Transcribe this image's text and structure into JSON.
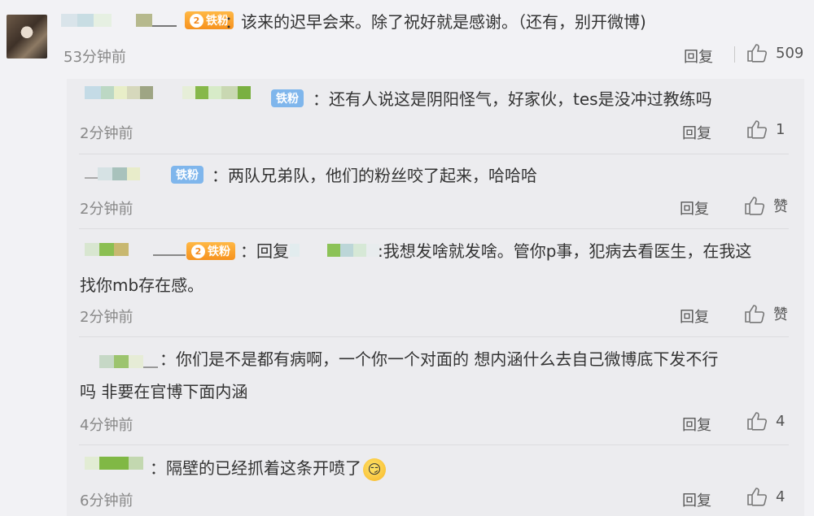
{
  "main_comment": {
    "badge": "铁粉",
    "badge_level": "2",
    "text": "：该来的迟早会来。除了祝好就是感谢。（还有，别开微博)",
    "time": "53分钟前",
    "reply_label": "回复",
    "likes": "509"
  },
  "replies": [
    {
      "badge": "铁粉",
      "text": "：还有人说这是阴阳怪气，好家伙，tes是没冲过教练吗",
      "time": "2分钟前",
      "reply_label": "回复",
      "likes": "1"
    },
    {
      "badge": "铁粉",
      "text": "：两队兄弟队，他们的粉丝咬了起来，哈哈哈",
      "time": "2分钟前",
      "reply_label": "回复",
      "likes": "赞"
    },
    {
      "badge": "铁粉",
      "badge_level": "2",
      "text_line1_a": "：回复",
      "text_line1_b": ":我想发啥就发啥。管你p事，犯病去看医生，在我这",
      "text_line2": "找你mb存在感。",
      "time": "2分钟前",
      "reply_label": "回复",
      "likes": "赞"
    },
    {
      "text_line1": "：你们是不是都有病啊，一个你一个对面的  想内涵什么去自己微博底下发不行",
      "text_line2": "吗  非要在官博下面内涵",
      "time": "4分钟前",
      "reply_label": "回复",
      "likes": "4"
    },
    {
      "text": "：隔壁的已经抓着这条开喷了",
      "time": "6分钟前",
      "reply_label": "回复",
      "likes": "4"
    }
  ],
  "colors": {
    "badge_orange": "#f6921e",
    "badge_blue": "#7fb6ec",
    "background": "#f2f2f5"
  },
  "icons": [
    "thumbs-up-icon",
    "smile-emoji-icon",
    "crown-level-icon"
  ]
}
